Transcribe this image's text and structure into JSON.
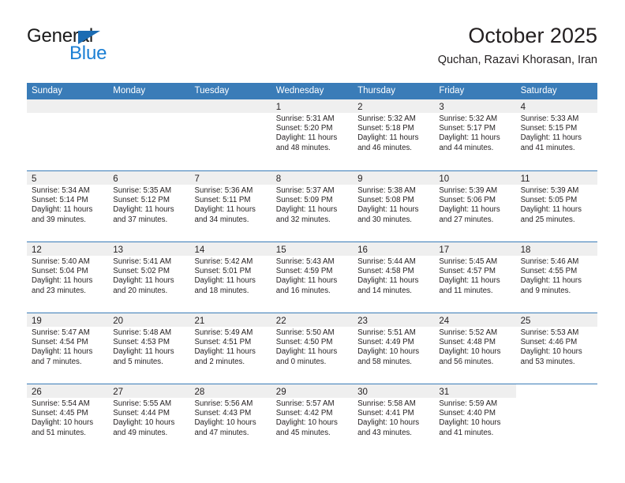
{
  "brand": {
    "name_top": "General",
    "name_bottom": "Blue",
    "accent_color": "#1b7fd4",
    "triangle_color": "#1b6cb3"
  },
  "header": {
    "title": "October 2025",
    "subtitle": "Quchan, Razavi Khorasan, Iran"
  },
  "calendar": {
    "header_bg": "#3a7cb8",
    "daynum_bg": "#efefef",
    "weekdays": [
      "Sunday",
      "Monday",
      "Tuesday",
      "Wednesday",
      "Thursday",
      "Friday",
      "Saturday"
    ],
    "weeks": [
      [
        {
          "day": "",
          "empty": true
        },
        {
          "day": "",
          "empty": true
        },
        {
          "day": "",
          "empty": true
        },
        {
          "day": "1",
          "sunrise": "Sunrise: 5:31 AM",
          "sunset": "Sunset: 5:20 PM",
          "daylight_1": "Daylight: 11 hours",
          "daylight_2": "and 48 minutes."
        },
        {
          "day": "2",
          "sunrise": "Sunrise: 5:32 AM",
          "sunset": "Sunset: 5:18 PM",
          "daylight_1": "Daylight: 11 hours",
          "daylight_2": "and 46 minutes."
        },
        {
          "day": "3",
          "sunrise": "Sunrise: 5:32 AM",
          "sunset": "Sunset: 5:17 PM",
          "daylight_1": "Daylight: 11 hours",
          "daylight_2": "and 44 minutes."
        },
        {
          "day": "4",
          "sunrise": "Sunrise: 5:33 AM",
          "sunset": "Sunset: 5:15 PM",
          "daylight_1": "Daylight: 11 hours",
          "daylight_2": "and 41 minutes."
        }
      ],
      [
        {
          "day": "5",
          "sunrise": "Sunrise: 5:34 AM",
          "sunset": "Sunset: 5:14 PM",
          "daylight_1": "Daylight: 11 hours",
          "daylight_2": "and 39 minutes."
        },
        {
          "day": "6",
          "sunrise": "Sunrise: 5:35 AM",
          "sunset": "Sunset: 5:12 PM",
          "daylight_1": "Daylight: 11 hours",
          "daylight_2": "and 37 minutes."
        },
        {
          "day": "7",
          "sunrise": "Sunrise: 5:36 AM",
          "sunset": "Sunset: 5:11 PM",
          "daylight_1": "Daylight: 11 hours",
          "daylight_2": "and 34 minutes."
        },
        {
          "day": "8",
          "sunrise": "Sunrise: 5:37 AM",
          "sunset": "Sunset: 5:09 PM",
          "daylight_1": "Daylight: 11 hours",
          "daylight_2": "and 32 minutes."
        },
        {
          "day": "9",
          "sunrise": "Sunrise: 5:38 AM",
          "sunset": "Sunset: 5:08 PM",
          "daylight_1": "Daylight: 11 hours",
          "daylight_2": "and 30 minutes."
        },
        {
          "day": "10",
          "sunrise": "Sunrise: 5:39 AM",
          "sunset": "Sunset: 5:06 PM",
          "daylight_1": "Daylight: 11 hours",
          "daylight_2": "and 27 minutes."
        },
        {
          "day": "11",
          "sunrise": "Sunrise: 5:39 AM",
          "sunset": "Sunset: 5:05 PM",
          "daylight_1": "Daylight: 11 hours",
          "daylight_2": "and 25 minutes."
        }
      ],
      [
        {
          "day": "12",
          "sunrise": "Sunrise: 5:40 AM",
          "sunset": "Sunset: 5:04 PM",
          "daylight_1": "Daylight: 11 hours",
          "daylight_2": "and 23 minutes."
        },
        {
          "day": "13",
          "sunrise": "Sunrise: 5:41 AM",
          "sunset": "Sunset: 5:02 PM",
          "daylight_1": "Daylight: 11 hours",
          "daylight_2": "and 20 minutes."
        },
        {
          "day": "14",
          "sunrise": "Sunrise: 5:42 AM",
          "sunset": "Sunset: 5:01 PM",
          "daylight_1": "Daylight: 11 hours",
          "daylight_2": "and 18 minutes."
        },
        {
          "day": "15",
          "sunrise": "Sunrise: 5:43 AM",
          "sunset": "Sunset: 4:59 PM",
          "daylight_1": "Daylight: 11 hours",
          "daylight_2": "and 16 minutes."
        },
        {
          "day": "16",
          "sunrise": "Sunrise: 5:44 AM",
          "sunset": "Sunset: 4:58 PM",
          "daylight_1": "Daylight: 11 hours",
          "daylight_2": "and 14 minutes."
        },
        {
          "day": "17",
          "sunrise": "Sunrise: 5:45 AM",
          "sunset": "Sunset: 4:57 PM",
          "daylight_1": "Daylight: 11 hours",
          "daylight_2": "and 11 minutes."
        },
        {
          "day": "18",
          "sunrise": "Sunrise: 5:46 AM",
          "sunset": "Sunset: 4:55 PM",
          "daylight_1": "Daylight: 11 hours",
          "daylight_2": "and 9 minutes."
        }
      ],
      [
        {
          "day": "19",
          "sunrise": "Sunrise: 5:47 AM",
          "sunset": "Sunset: 4:54 PM",
          "daylight_1": "Daylight: 11 hours",
          "daylight_2": "and 7 minutes."
        },
        {
          "day": "20",
          "sunrise": "Sunrise: 5:48 AM",
          "sunset": "Sunset: 4:53 PM",
          "daylight_1": "Daylight: 11 hours",
          "daylight_2": "and 5 minutes."
        },
        {
          "day": "21",
          "sunrise": "Sunrise: 5:49 AM",
          "sunset": "Sunset: 4:51 PM",
          "daylight_1": "Daylight: 11 hours",
          "daylight_2": "and 2 minutes."
        },
        {
          "day": "22",
          "sunrise": "Sunrise: 5:50 AM",
          "sunset": "Sunset: 4:50 PM",
          "daylight_1": "Daylight: 11 hours",
          "daylight_2": "and 0 minutes."
        },
        {
          "day": "23",
          "sunrise": "Sunrise: 5:51 AM",
          "sunset": "Sunset: 4:49 PM",
          "daylight_1": "Daylight: 10 hours",
          "daylight_2": "and 58 minutes."
        },
        {
          "day": "24",
          "sunrise": "Sunrise: 5:52 AM",
          "sunset": "Sunset: 4:48 PM",
          "daylight_1": "Daylight: 10 hours",
          "daylight_2": "and 56 minutes."
        },
        {
          "day": "25",
          "sunrise": "Sunrise: 5:53 AM",
          "sunset": "Sunset: 4:46 PM",
          "daylight_1": "Daylight: 10 hours",
          "daylight_2": "and 53 minutes."
        }
      ],
      [
        {
          "day": "26",
          "sunrise": "Sunrise: 5:54 AM",
          "sunset": "Sunset: 4:45 PM",
          "daylight_1": "Daylight: 10 hours",
          "daylight_2": "and 51 minutes."
        },
        {
          "day": "27",
          "sunrise": "Sunrise: 5:55 AM",
          "sunset": "Sunset: 4:44 PM",
          "daylight_1": "Daylight: 10 hours",
          "daylight_2": "and 49 minutes."
        },
        {
          "day": "28",
          "sunrise": "Sunrise: 5:56 AM",
          "sunset": "Sunset: 4:43 PM",
          "daylight_1": "Daylight: 10 hours",
          "daylight_2": "and 47 minutes."
        },
        {
          "day": "29",
          "sunrise": "Sunrise: 5:57 AM",
          "sunset": "Sunset: 4:42 PM",
          "daylight_1": "Daylight: 10 hours",
          "daylight_2": "and 45 minutes."
        },
        {
          "day": "30",
          "sunrise": "Sunrise: 5:58 AM",
          "sunset": "Sunset: 4:41 PM",
          "daylight_1": "Daylight: 10 hours",
          "daylight_2": "and 43 minutes."
        },
        {
          "day": "31",
          "sunrise": "Sunrise: 5:59 AM",
          "sunset": "Sunset: 4:40 PM",
          "daylight_1": "Daylight: 10 hours",
          "daylight_2": "and 41 minutes."
        },
        {
          "day": "",
          "empty": true,
          "blank": true
        }
      ]
    ]
  }
}
